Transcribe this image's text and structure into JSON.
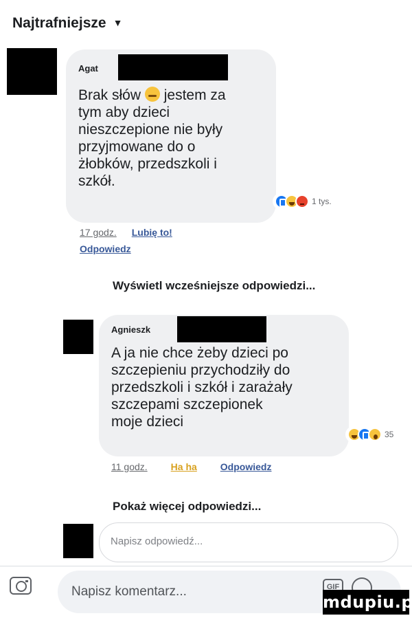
{
  "header": {
    "sort_label": "Najtrafniejsze",
    "chevron_icon": "chevron-down-icon"
  },
  "comments": [
    {
      "author_prefix": "Agat",
      "text_lines": [
        "Brak słów",
        "jestem za",
        "tym aby dzieci",
        "nieszczepione nie były",
        "przyjmowane do o",
        "żłobków, przedszkoli i",
        "szkół."
      ],
      "inline_emoji": "persevering-face-emoji",
      "reactions": [
        "like",
        "haha",
        "angry"
      ],
      "reaction_count": "1 tys.",
      "time": "17 godz.",
      "actions": [
        "Lubię to!",
        "Odpowiedz"
      ]
    },
    {
      "author_prefix": "Agnieszk",
      "text_lines": [
        "A ja nie chce żeby dzieci po",
        "szczepieniu przychodziły do",
        "przedszkoli i szkół i zarażały",
        "szczepami szczepionek",
        "moje dzieci"
      ],
      "reactions": [
        "haha",
        "like",
        "wow"
      ],
      "reaction_count": "35",
      "time": "11 godz.",
      "actions": [
        "Ha ha",
        "Odpowiedz"
      ]
    }
  ],
  "thread": {
    "previous_replies": "Wyświetl wcześniejsze odpowiedzi...",
    "more_replies": "Pokaż więcej odpowiedzi...",
    "reply_placeholder": "Napisz odpowiedź..."
  },
  "composer": {
    "placeholder": "Napisz komentarz...",
    "gif_label": "GIF",
    "camera_icon": "camera-icon",
    "emoji_icon": "smile-icon"
  },
  "watermark": "mdupiu.pl"
}
